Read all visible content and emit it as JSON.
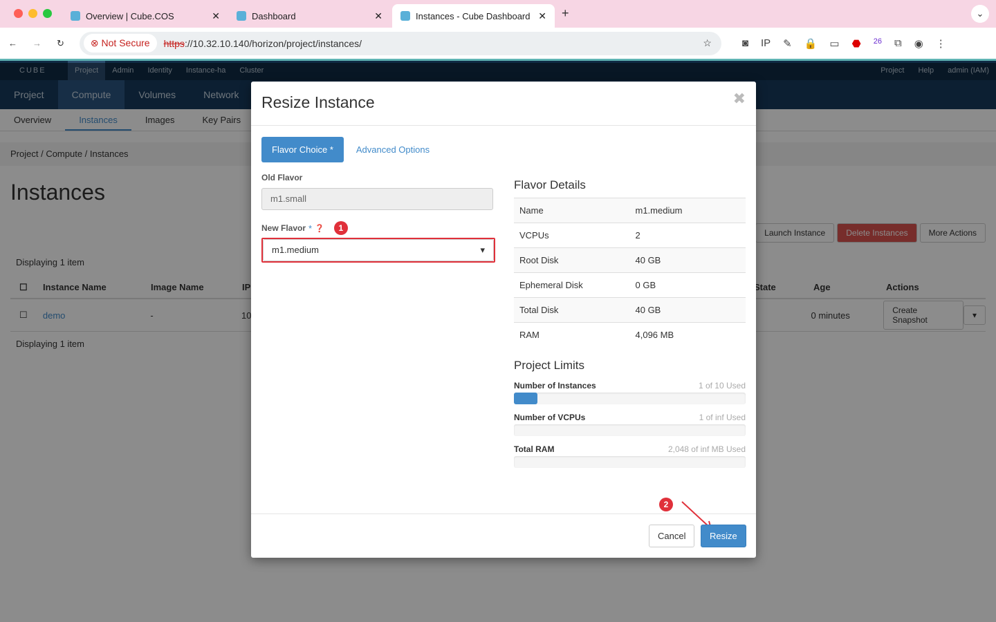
{
  "browser": {
    "tabs": [
      {
        "title": "Overview | Cube.COS"
      },
      {
        "title": "Dashboard"
      },
      {
        "title": "Instances - Cube Dashboard"
      }
    ],
    "not_secure": "Not Secure",
    "url_scheme": "https",
    "url_rest": "://10.32.10.140/horizon/project/instances/",
    "ext_badge": "26"
  },
  "topnav": {
    "brand": "CUBE",
    "items": [
      "Project",
      "Admin",
      "Identity",
      "Instance-ha",
      "Cluster"
    ],
    "right": [
      "Project",
      "Help",
      "admin (IAM)"
    ]
  },
  "secnav": [
    "Project",
    "Compute",
    "Volumes",
    "Network"
  ],
  "subnav": [
    "Overview",
    "Instances",
    "Images",
    "Key Pairs"
  ],
  "breadcrumb": [
    "Project",
    "Compute",
    "Instances"
  ],
  "page": {
    "title": "Instances",
    "launch": "Launch Instance",
    "delete": "Delete Instances",
    "more": "More Actions",
    "displaying": "Displaying 1 item",
    "columns": [
      "Instance Name",
      "Image Name",
      "IP",
      "State",
      "Age",
      "Actions"
    ],
    "row": {
      "name": "demo",
      "image": "-",
      "ip": "10",
      "age": "0 minutes",
      "action": "Create Snapshot"
    }
  },
  "modal": {
    "title": "Resize Instance",
    "tabs": [
      "Flavor Choice",
      "Advanced Options"
    ],
    "old_flavor_label": "Old Flavor",
    "old_flavor": "m1.small",
    "new_flavor_label": "New Flavor",
    "new_flavor": "m1.medium",
    "details_title": "Flavor Details",
    "details": [
      [
        "Name",
        "m1.medium"
      ],
      [
        "VCPUs",
        "2"
      ],
      [
        "Root Disk",
        "40 GB"
      ],
      [
        "Ephemeral Disk",
        "0 GB"
      ],
      [
        "Total Disk",
        "40 GB"
      ],
      [
        "RAM",
        "4,096 MB"
      ]
    ],
    "limits_title": "Project Limits",
    "limits": [
      {
        "label": "Number of Instances",
        "used": "1 of 10 Used",
        "fraction": 0.1
      },
      {
        "label": "Number of VCPUs",
        "used": "1 of inf Used",
        "fraction": 0
      },
      {
        "label": "Total RAM",
        "used": "2,048 of inf MB Used",
        "fraction": 0
      }
    ],
    "cancel": "Cancel",
    "resize": "Resize",
    "annotations": [
      "1",
      "2"
    ]
  },
  "colors": {
    "primary": "#428bca",
    "annotation": "#e0303a",
    "navbar": "#0f2a44"
  }
}
